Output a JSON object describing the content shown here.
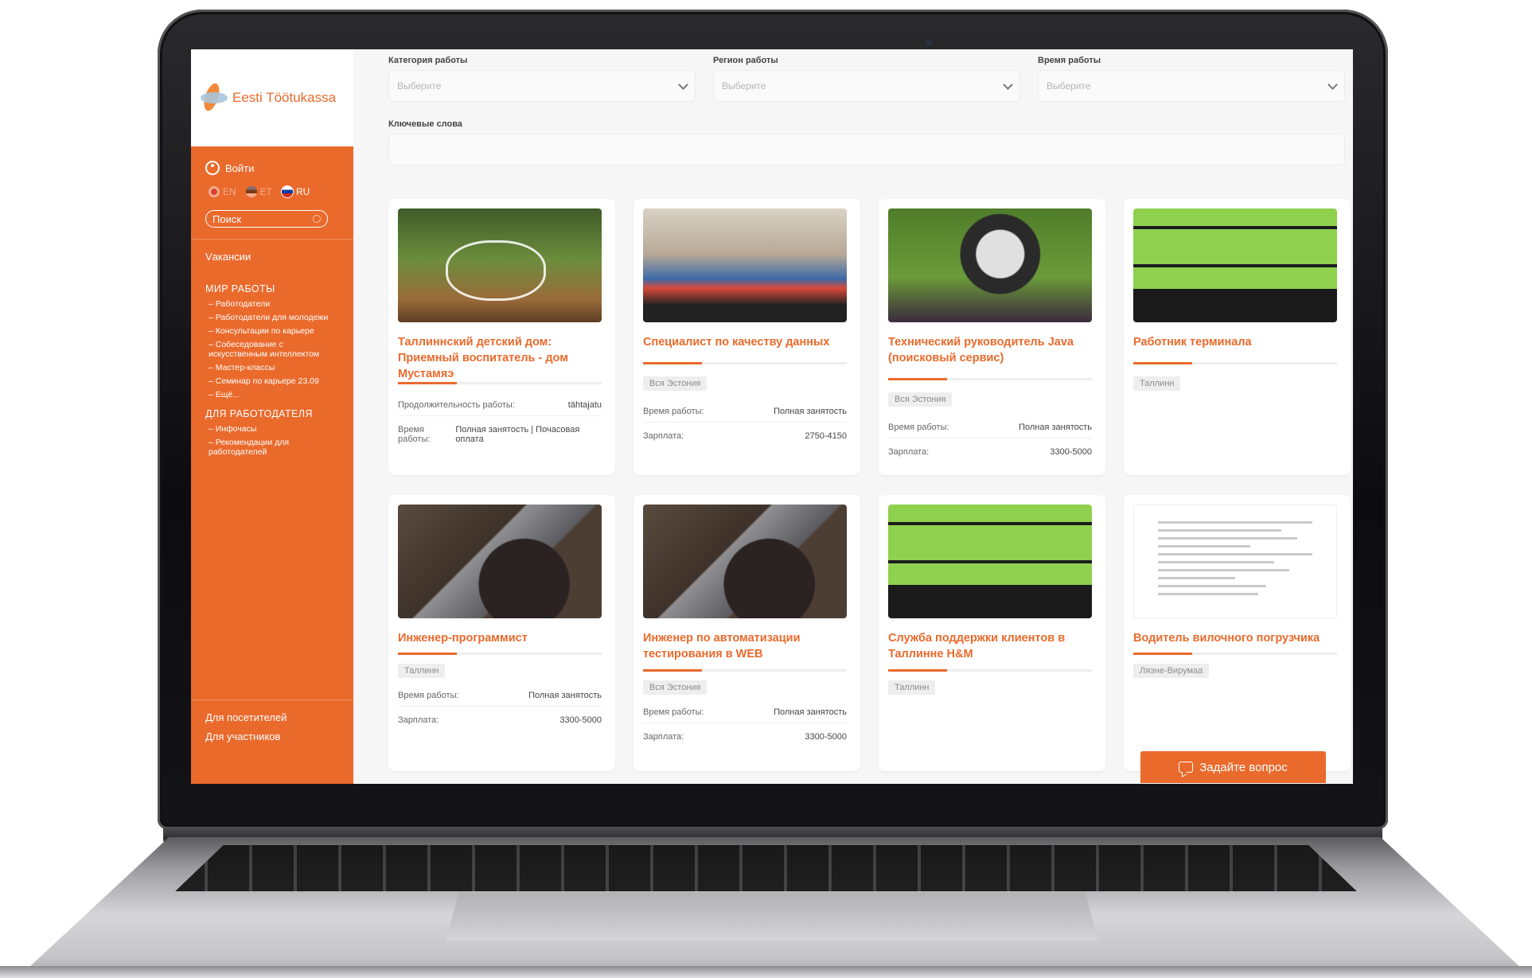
{
  "brand": {
    "name": "Eesti Töötukassa"
  },
  "sidebar": {
    "login": "Войти",
    "languages": [
      {
        "code": "EN",
        "active": false
      },
      {
        "code": "ET",
        "active": false
      },
      {
        "code": "RU",
        "active": true
      }
    ],
    "search_placeholder": "Поиск",
    "main_link": "Vакансии",
    "sections": [
      {
        "title": "МИР РАБОТЫ",
        "items": [
          "– Работодатели",
          "– Работодатели для молодежи",
          "– Консультации по карьере",
          "– Собеседование с искусственным интеллектом",
          "– Мастер-классы",
          "– Семинар по карьере 23.09",
          "– Ещё..."
        ]
      },
      {
        "title": "ДЛЯ РАБОТОДАТЕЛЯ",
        "items": [
          "– Инфочасы",
          "– Рекомендации для работодателей"
        ]
      }
    ],
    "bottom_links": [
      "Для посетителей",
      "Для участников"
    ]
  },
  "filters": {
    "category": {
      "label": "Категория работы",
      "placeholder": "Выберите"
    },
    "region": {
      "label": "Регион работы",
      "placeholder": "Выберите"
    },
    "time": {
      "label": "Время работы",
      "placeholder": "Выберите"
    },
    "keywords": {
      "label": "Ключевые слова",
      "value": ""
    }
  },
  "jobs": [
    {
      "title": "Таллиннский детский дом: Приемный воспитатель - дом Мустамяэ",
      "image": "park-family-icon",
      "tag": "",
      "rows": [
        [
          "Продолжительность работы:",
          "tähtajatu"
        ],
        [
          "Время работы:",
          "Полная занятость | Почасовая оплата"
        ]
      ]
    },
    {
      "title": "Специалист по качеству данных",
      "image": "office-meeting-icon",
      "tag": "Вся Эстония",
      "rows": [
        [
          "Время работы:",
          "Полная занятость"
        ],
        [
          "Зарплата:",
          "2750-4150"
        ]
      ]
    },
    {
      "title": "Технический руководитель Java (поисковый сервис)",
      "image": "laptop-grass-icon",
      "tag": "Вся Эстония",
      "rows": [
        [
          "Время работы:",
          "Полная занятость"
        ],
        [
          "Зарплата:",
          "3300-5000"
        ]
      ]
    },
    {
      "title": "Работник терминала",
      "image": "tööle-kohe-banner-icon",
      "tag": "Таллинн",
      "rows": []
    },
    {
      "title": "Инженер-программист",
      "image": "desk-laptop-icon",
      "tag": "Таллинн",
      "rows": [
        [
          "Время работы:",
          "Полная занятость"
        ],
        [
          "Зарплата:",
          "3300-5000"
        ]
      ]
    },
    {
      "title": "Инженер по автоматизации тестирования в WEB",
      "image": "desk-laptop-icon",
      "tag": "Вся Эстония",
      "rows": [
        [
          "Время работы:",
          "Полная занятость"
        ],
        [
          "Зарплата:",
          "3300-5000"
        ]
      ]
    },
    {
      "title": "Служба поддержки клиентов в Таллинне H&M",
      "image": "tööle-kohe-banner-icon",
      "tag": "Таллинн",
      "rows": []
    },
    {
      "title": "Водитель вилочного погрузчика",
      "image": "document-icon",
      "tag": "Ляэне-Вирумаа",
      "rows": []
    }
  ],
  "ask_button": "Задайте вопрос",
  "colors": {
    "accent": "#ea6a2c",
    "background": "#f6f6f7"
  }
}
